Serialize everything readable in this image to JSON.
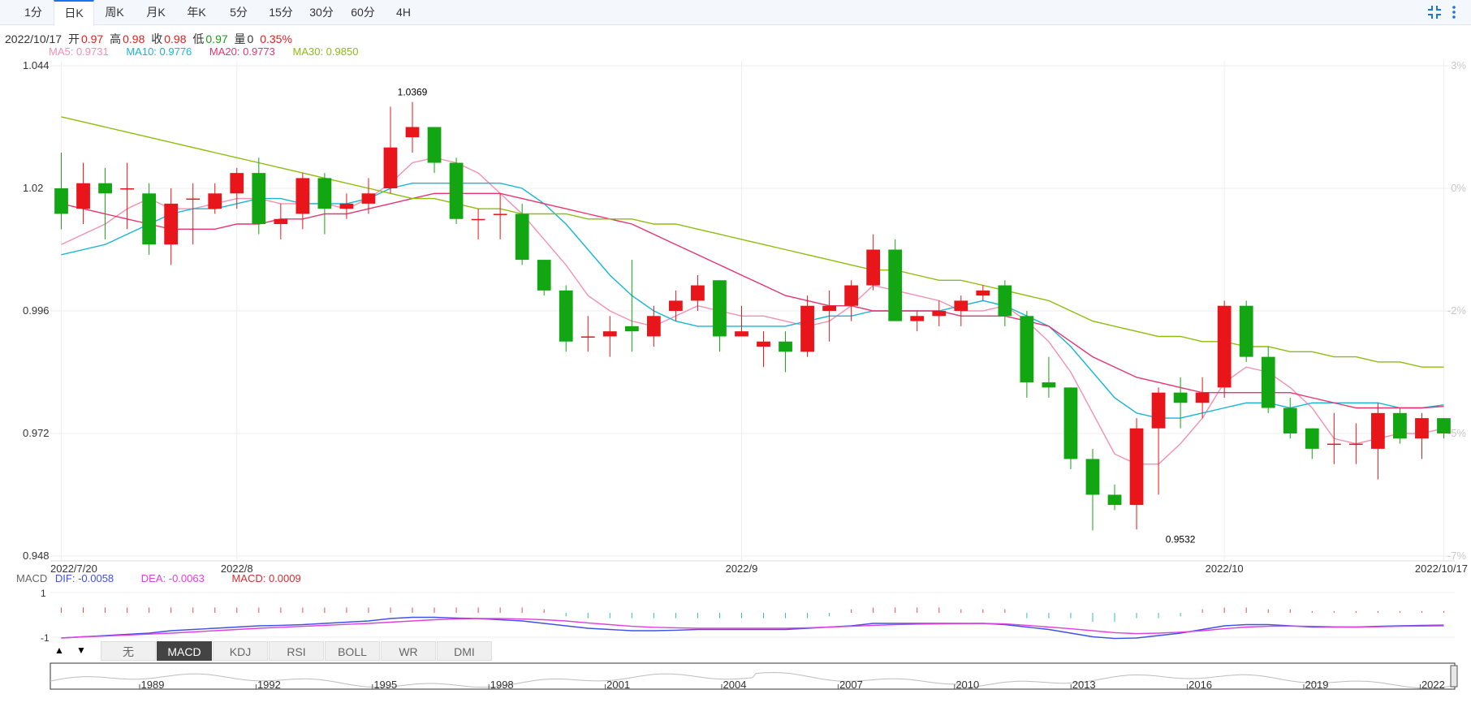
{
  "tabs": [
    {
      "label": "1分",
      "active": false
    },
    {
      "label": "日K",
      "active": true
    },
    {
      "label": "周K",
      "active": false
    },
    {
      "label": "月K",
      "active": false
    },
    {
      "label": "年K",
      "active": false
    },
    {
      "label": "5分",
      "active": false
    },
    {
      "label": "15分",
      "active": false
    },
    {
      "label": "30分",
      "active": false
    },
    {
      "label": "60分",
      "active": false
    },
    {
      "label": "4H",
      "active": false
    }
  ],
  "toolbar": {
    "icons": [
      "shrink-icon",
      "more-vertical-icon"
    ]
  },
  "info": {
    "date": "2022/10/17",
    "open_label": "开",
    "open": "0.97",
    "high_label": "高",
    "high": "0.98",
    "close_label": "收",
    "close": "0.98",
    "low_label": "低",
    "low": "0.97",
    "volume_label": "量",
    "volume": "0",
    "change": "0.35%"
  },
  "ma": [
    {
      "label": "MA5: 0.9731",
      "color": "#f48fb1"
    },
    {
      "label": "MA10: 0.9776",
      "color": "#17b5d6"
    },
    {
      "label": "MA20: 0.9773",
      "color": "#e8336e"
    },
    {
      "label": "MA30: 0.9850",
      "color": "#8ebd0c"
    }
  ],
  "macd_info": {
    "name": "MACD",
    "dif": "DIF: -0.0058",
    "dif_color": "#3f51e6",
    "dea": "DEA: -0.0063",
    "dea_color": "#e040e0",
    "macd": "MACD: 0.0009",
    "macd_color": "#d03030"
  },
  "indicator_tabs": [
    {
      "label": "无",
      "active": false
    },
    {
      "label": "MACD",
      "active": true
    },
    {
      "label": "KDJ",
      "active": false
    },
    {
      "label": "RSI",
      "active": false
    },
    {
      "label": "BOLL",
      "active": false
    },
    {
      "label": "WR",
      "active": false
    },
    {
      "label": "DMI",
      "active": false
    }
  ],
  "chart_data": {
    "type": "candlestick",
    "up_color": "#e8161a",
    "down_color": "#11a612",
    "ylim": [
      0.948,
      1.044
    ],
    "y_ticks": [
      "1.044",
      "1.02",
      "0.996",
      "0.972",
      "0.948"
    ],
    "y_tick_values": [
      1.044,
      1.02,
      0.996,
      0.972,
      0.948
    ],
    "right_ticks": [
      "3%",
      "0%",
      "-2%",
      "-5%",
      "-7%"
    ],
    "right_tick_values": [
      1.044,
      1.02,
      0.996,
      0.972,
      0.948
    ],
    "x_labels": [
      {
        "label": "2022/7/20",
        "index": 0
      },
      {
        "label": "2022/8",
        "index": 8
      },
      {
        "label": "2022/9",
        "index": 31
      },
      {
        "label": "2022/10",
        "index": 53
      },
      {
        "label": "2022/10/17",
        "index": 63
      }
    ],
    "annotations": [
      {
        "label": "1.0369",
        "index": 16,
        "value": 1.0369,
        "position": "above"
      },
      {
        "label": "0.9532",
        "index": 51,
        "value": 0.9532,
        "position": "below"
      }
    ],
    "candles": [
      [
        1.02,
        1.015,
        1.027,
        1.012
      ],
      [
        1.016,
        1.021,
        1.025,
        1.013
      ],
      [
        1.021,
        1.019,
        1.024,
        1.01
      ],
      [
        1.02,
        1.02,
        1.025,
        1.012
      ],
      [
        1.019,
        1.009,
        1.021,
        1.007
      ],
      [
        1.009,
        1.017,
        1.02,
        1.005
      ],
      [
        1.018,
        1.018,
        1.021,
        1.009
      ],
      [
        1.016,
        1.019,
        1.021,
        1.015
      ],
      [
        1.019,
        1.023,
        1.024,
        1.016
      ],
      [
        1.023,
        1.013,
        1.026,
        1.011
      ],
      [
        1.013,
        1.014,
        1.017,
        1.01
      ],
      [
        1.015,
        1.022,
        1.023,
        1.012
      ],
      [
        1.022,
        1.016,
        1.023,
        1.011
      ],
      [
        1.016,
        1.017,
        1.019,
        1.014
      ],
      [
        1.017,
        1.019,
        1.022,
        1.015
      ],
      [
        1.02,
        1.028,
        1.036,
        1.019
      ],
      [
        1.03,
        1.032,
        1.0369,
        1.027
      ],
      [
        1.032,
        1.025,
        1.032,
        1.023
      ],
      [
        1.025,
        1.014,
        1.026,
        1.013
      ],
      [
        1.014,
        1.014,
        1.016,
        1.01
      ],
      [
        1.015,
        1.015,
        1.019,
        1.01
      ],
      [
        1.015,
        1.006,
        1.017,
        1.005
      ],
      [
        1.006,
        1.0,
        1.006,
        0.999
      ],
      [
        1.0,
        0.99,
        1.001,
        0.988
      ],
      [
        0.991,
        0.991,
        0.995,
        0.988
      ],
      [
        0.991,
        0.992,
        0.995,
        0.987
      ],
      [
        0.993,
        0.992,
        1.006,
        0.988
      ],
      [
        0.991,
        0.995,
        0.997,
        0.989
      ],
      [
        0.996,
        0.998,
        1.0,
        0.994
      ],
      [
        0.998,
        1.001,
        1.003,
        0.996
      ],
      [
        1.002,
        0.991,
        1.002,
        0.988
      ],
      [
        0.991,
        0.992,
        0.997,
        0.991
      ],
      [
        0.989,
        0.99,
        0.992,
        0.985
      ],
      [
        0.99,
        0.988,
        0.992,
        0.984
      ],
      [
        0.988,
        0.997,
        0.999,
        0.987
      ],
      [
        0.996,
        0.997,
        1.0,
        0.99
      ],
      [
        0.997,
        1.001,
        1.002,
        0.994
      ],
      [
        1.001,
        1.008,
        1.011,
        1.0
      ],
      [
        1.008,
        0.994,
        1.01,
        0.994
      ],
      [
        0.994,
        0.995,
        0.996,
        0.992
      ],
      [
        0.995,
        0.996,
        0.998,
        0.993
      ],
      [
        0.996,
        0.998,
        0.999,
        0.993
      ],
      [
        0.999,
        1.0,
        1.001,
        0.998
      ],
      [
        1.001,
        0.995,
        1.002,
        0.993
      ],
      [
        0.995,
        0.982,
        0.996,
        0.979
      ],
      [
        0.982,
        0.981,
        0.987,
        0.979
      ],
      [
        0.981,
        0.967,
        0.981,
        0.965
      ],
      [
        0.967,
        0.96,
        0.969,
        0.953
      ],
      [
        0.96,
        0.958,
        0.962,
        0.957
      ],
      [
        0.958,
        0.973,
        0.975,
        0.9532
      ],
      [
        0.973,
        0.98,
        0.981,
        0.96
      ],
      [
        0.98,
        0.978,
        0.983,
        0.973
      ],
      [
        0.978,
        0.98,
        0.983,
        0.975
      ],
      [
        0.981,
        0.997,
        0.998,
        0.979
      ],
      [
        0.997,
        0.987,
        0.998,
        0.986
      ],
      [
        0.987,
        0.977,
        0.989,
        0.976
      ],
      [
        0.977,
        0.972,
        0.979,
        0.971
      ],
      [
        0.973,
        0.969,
        0.973,
        0.967
      ],
      [
        0.97,
        0.97,
        0.976,
        0.966
      ],
      [
        0.97,
        0.97,
        0.974,
        0.966
      ],
      [
        0.969,
        0.976,
        0.978,
        0.963
      ],
      [
        0.976,
        0.971,
        0.977,
        0.97
      ],
      [
        0.971,
        0.975,
        0.976,
        0.967
      ],
      [
        0.975,
        0.972,
        0.975,
        0.971
      ]
    ],
    "ma_series": [
      {
        "name": "MA5",
        "color": "#f48fb1",
        "values": [
          1.009,
          1.011,
          1.013,
          1.016,
          1.018,
          1.016,
          1.016,
          1.017,
          1.018,
          1.018,
          1.017,
          1.017,
          1.017,
          1.016,
          1.018,
          1.021,
          1.025,
          1.026,
          1.025,
          1.023,
          1.019,
          1.015,
          1.01,
          1.005,
          0.999,
          0.996,
          0.994,
          0.993,
          0.995,
          0.997,
          0.996,
          0.995,
          0.995,
          0.994,
          0.993,
          0.994,
          0.997,
          1.001,
          1.0,
          0.999,
          0.998,
          0.996,
          0.996,
          0.997,
          0.994,
          0.99,
          0.984,
          0.976,
          0.968,
          0.966,
          0.966,
          0.97,
          0.975,
          0.982,
          0.985,
          0.984,
          0.981,
          0.977,
          0.971,
          0.97,
          0.971,
          0.972,
          0.972,
          0.973
        ]
      },
      {
        "name": "MA10",
        "color": "#17b5d6",
        "values": [
          1.007,
          1.008,
          1.009,
          1.011,
          1.013,
          1.015,
          1.016,
          1.016,
          1.017,
          1.018,
          1.018,
          1.017,
          1.017,
          1.017,
          1.018,
          1.02,
          1.021,
          1.021,
          1.021,
          1.021,
          1.021,
          1.02,
          1.017,
          1.013,
          1.008,
          1.003,
          0.999,
          0.996,
          0.994,
          0.993,
          0.993,
          0.993,
          0.993,
          0.993,
          0.994,
          0.995,
          0.995,
          0.996,
          0.996,
          0.996,
          0.996,
          0.997,
          0.998,
          0.997,
          0.995,
          0.993,
          0.989,
          0.984,
          0.979,
          0.976,
          0.975,
          0.975,
          0.976,
          0.977,
          0.978,
          0.978,
          0.977,
          0.978,
          0.978,
          0.978,
          0.978,
          0.977,
          0.977,
          0.9776
        ]
      },
      {
        "name": "MA20",
        "color": "#e8336e",
        "values": [
          1.017,
          1.016,
          1.015,
          1.014,
          1.013,
          1.012,
          1.012,
          1.012,
          1.013,
          1.013,
          1.014,
          1.014,
          1.015,
          1.015,
          1.016,
          1.017,
          1.018,
          1.019,
          1.019,
          1.019,
          1.019,
          1.018,
          1.017,
          1.016,
          1.015,
          1.014,
          1.013,
          1.011,
          1.009,
          1.007,
          1.005,
          1.003,
          1.001,
          0.999,
          0.998,
          0.997,
          0.997,
          0.996,
          0.996,
          0.996,
          0.996,
          0.995,
          0.995,
          0.995,
          0.994,
          0.993,
          0.99,
          0.987,
          0.985,
          0.983,
          0.982,
          0.981,
          0.98,
          0.98,
          0.98,
          0.98,
          0.98,
          0.979,
          0.978,
          0.977,
          0.977,
          0.977,
          0.977,
          0.9773
        ]
      },
      {
        "name": "MA30",
        "color": "#8ebd0c",
        "values": [
          1.034,
          1.033,
          1.032,
          1.031,
          1.03,
          1.029,
          1.028,
          1.027,
          1.026,
          1.025,
          1.024,
          1.023,
          1.022,
          1.021,
          1.02,
          1.019,
          1.018,
          1.018,
          1.017,
          1.016,
          1.016,
          1.015,
          1.015,
          1.015,
          1.014,
          1.014,
          1.014,
          1.013,
          1.013,
          1.012,
          1.011,
          1.01,
          1.009,
          1.008,
          1.007,
          1.006,
          1.005,
          1.004,
          1.004,
          1.003,
          1.002,
          1.002,
          1.001,
          1.0,
          0.999,
          0.998,
          0.996,
          0.994,
          0.993,
          0.992,
          0.991,
          0.991,
          0.99,
          0.99,
          0.989,
          0.989,
          0.988,
          0.988,
          0.987,
          0.987,
          0.986,
          0.986,
          0.985,
          0.985
        ]
      }
    ],
    "macd": {
      "ylim": [
        -1,
        1
      ],
      "y_ticks": [
        "1",
        "-1"
      ],
      "y_tick_values": [
        1,
        -1
      ],
      "hist": [
        0.3,
        0.3,
        0.3,
        0.3,
        0.3,
        0.3,
        0.3,
        0.3,
        0.3,
        0.3,
        0.3,
        0.3,
        0.3,
        0.3,
        0.3,
        0.3,
        0.3,
        0.3,
        0.3,
        0.3,
        0.3,
        0.3,
        0.2,
        -0.2,
        -0.3,
        -0.3,
        -0.3,
        -0.3,
        -0.3,
        -0.3,
        -0.3,
        -0.3,
        -0.3,
        -0.3,
        -0.3,
        -0.2,
        0.2,
        0.3,
        0.3,
        0.3,
        0.3,
        0.2,
        0.2,
        0.2,
        -0.3,
        -0.3,
        -0.3,
        -0.5,
        -0.5,
        -0.3,
        -0.3,
        -0.2,
        0.2,
        0.3,
        0.3,
        0.2,
        0.2,
        0.1,
        0.1,
        0.1,
        0.1,
        0.1,
        0.1,
        0.1
      ],
      "dif": [
        -0.9,
        -0.85,
        -0.8,
        -0.75,
        -0.7,
        -0.6,
        -0.55,
        -0.5,
        -0.45,
        -0.4,
        -0.38,
        -0.35,
        -0.3,
        -0.25,
        -0.2,
        -0.1,
        -0.05,
        -0.05,
        -0.08,
        -0.1,
        -0.15,
        -0.2,
        -0.3,
        -0.4,
        -0.5,
        -0.55,
        -0.6,
        -0.6,
        -0.58,
        -0.55,
        -0.55,
        -0.55,
        -0.55,
        -0.55,
        -0.5,
        -0.45,
        -0.4,
        -0.3,
        -0.3,
        -0.3,
        -0.3,
        -0.3,
        -0.3,
        -0.35,
        -0.45,
        -0.55,
        -0.7,
        -0.85,
        -0.92,
        -0.9,
        -0.8,
        -0.7,
        -0.55,
        -0.4,
        -0.35,
        -0.35,
        -0.4,
        -0.45,
        -0.45,
        -0.45,
        -0.42,
        -0.4,
        -0.38,
        -0.37
      ],
      "dea": [
        -0.9,
        -0.85,
        -0.82,
        -0.78,
        -0.74,
        -0.7,
        -0.65,
        -0.6,
        -0.55,
        -0.5,
        -0.46,
        -0.42,
        -0.38,
        -0.34,
        -0.3,
        -0.25,
        -0.2,
        -0.15,
        -0.12,
        -0.1,
        -0.1,
        -0.12,
        -0.15,
        -0.2,
        -0.28,
        -0.35,
        -0.42,
        -0.46,
        -0.48,
        -0.5,
        -0.5,
        -0.5,
        -0.5,
        -0.5,
        -0.48,
        -0.45,
        -0.42,
        -0.38,
        -0.35,
        -0.33,
        -0.32,
        -0.31,
        -0.3,
        -0.32,
        -0.38,
        -0.45,
        -0.52,
        -0.6,
        -0.68,
        -0.72,
        -0.7,
        -0.66,
        -0.6,
        -0.52,
        -0.45,
        -0.42,
        -0.41,
        -0.42,
        -0.44,
        -0.45,
        -0.44,
        -0.42,
        -0.41,
        -0.4
      ]
    },
    "navigator": {
      "labels": [
        "1989",
        "1992",
        "1995",
        "1998",
        "2001",
        "2004",
        "2007",
        "2010",
        "2013",
        "2016",
        "2019",
        "2022"
      ]
    }
  }
}
